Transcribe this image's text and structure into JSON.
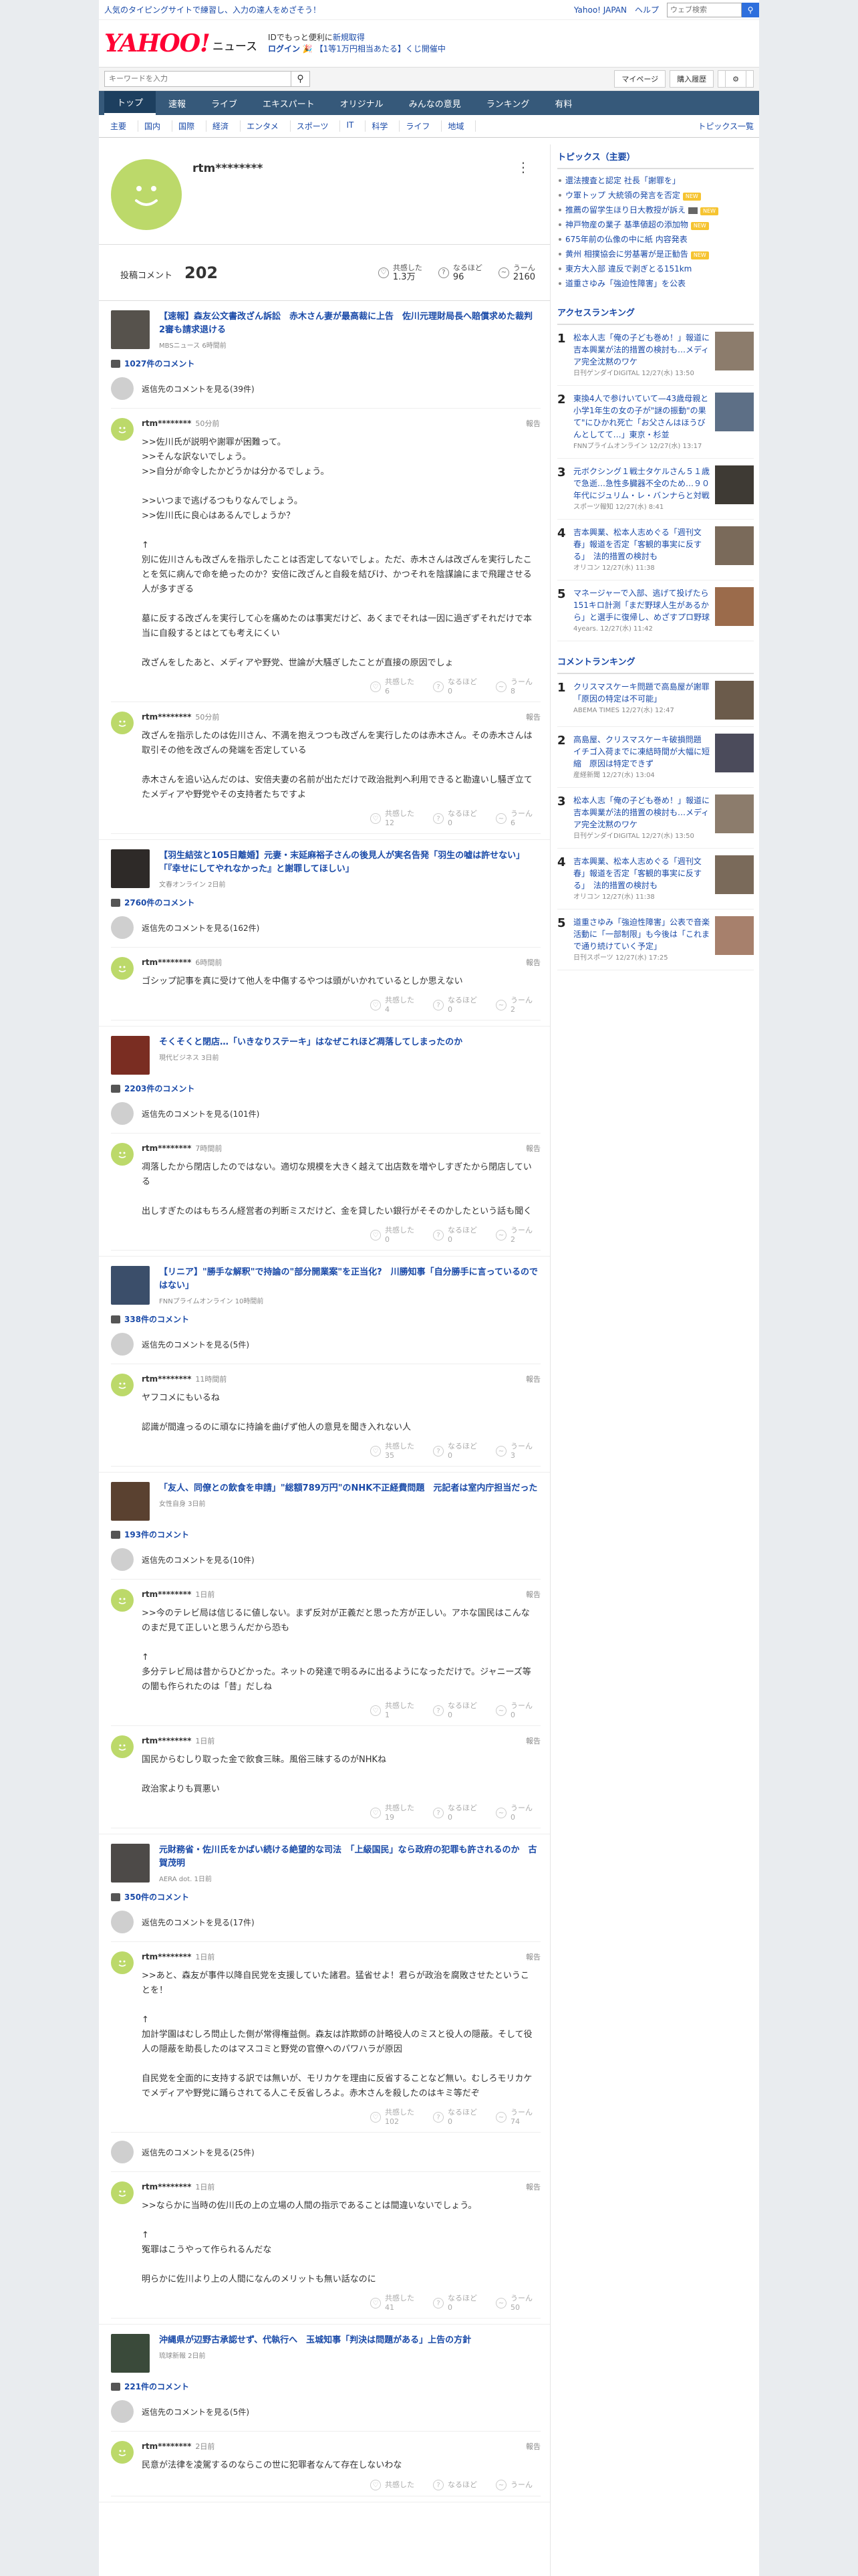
{
  "promo": {
    "left": "人気のタイピングサイトで練習し、入力の達人をめざそう！",
    "links": [
      "Yahoo! JAPAN",
      "ヘルプ"
    ],
    "search_placeholder": "ウェブ検索"
  },
  "brand": {
    "logo": "YAHOO!",
    "logo_sub": "JAPAN",
    "section": "ニュース",
    "line1_prefix": "IDでもっと便利に",
    "line1_link": "新規取得",
    "line2_login": "ログイン",
    "line2_campaign": "【1等1万円相当あたる】くじ開催中"
  },
  "search": {
    "placeholder": "キーワードを入力",
    "mypage": "マイページ",
    "purchase": "購入履歴"
  },
  "global_nav": [
    "トップ",
    "速報",
    "ライブ",
    "エキスパート",
    "オリジナル",
    "みんなの意見",
    "ランキング",
    "有料"
  ],
  "sub_nav": [
    "主要",
    "国内",
    "国際",
    "経済",
    "エンタメ",
    "スポーツ",
    "IT",
    "科学",
    "ライフ",
    "地域"
  ],
  "sub_nav_all": "トピックス一覧",
  "profile": {
    "name": "rtm********",
    "comments_label": "投稿コメント",
    "comments_count": "202",
    "reactions": [
      {
        "label": "共感した",
        "value": "1.3万"
      },
      {
        "label": "なるほど",
        "value": "96"
      },
      {
        "label": "うーん",
        "value": "2160"
      }
    ]
  },
  "labels": {
    "view_prev": "返信先のコメントを見る",
    "report": "報告",
    "agree": "共感した",
    "hmm": "なるほど",
    "well": "うーん"
  },
  "articles": [
    {
      "title": "【速報】森友公文書改ざん訴訟　赤木さん妻が最高裁に上告　佐川元理財局長へ賠償求めた裁判　2審も請求退ける",
      "source": "MBSニュース 6時間前",
      "thumb": "#56524c",
      "comment_count": "1027件のコメント",
      "prev": "返信先のコメントを見る(39件)",
      "comments": [
        {
          "user": "rtm********",
          "time": "50分前",
          "text": ">>佐川氏が説明や謝罪が困難って。\n>>そんな訳ないでしょう。\n>>自分が命令したかどうかは分かるでしょう。\n\n>>いつまで逃げるつもりなんでしょう。\n>>佐川氏に良心はあるんでしょうか？\n\n↑\n別に佐川さんも改ざんを指示したことは否定してないでしょ。ただ、赤木さんは改ざんを実行したことを気に病んで命を絶ったのか？安倍に改ざんと自殺を結びけ、かつそれを陰謀論にまで飛躍させる人が多すぎる\n\n墓に反する改ざんを実行して心を痛めたのは事実だけど、あくまでそれは一因に過ぎずそれだけで本当に自殺するとはとても考えにくい\n\n改ざんをしたあと、メディアや野党、世論が大騒ぎしたことが直接の原因でしょ",
          "r": [
            "6",
            "0",
            "8"
          ]
        },
        {
          "user": "rtm********",
          "time": "50分前",
          "text": "改ざんを指示したのは佐川さん、不満を抱えつつも改ざんを実行したのは赤木さん。その赤木さんは取引その他を改ざんの発端を否定している\n\n赤木さんを追い込んだのは、安倍夫妻の名前が出ただけで政治批判へ利用できると勘違いし騒ぎ立てたメディアや野党やその支持者たちですよ",
          "r": [
            "12",
            "0",
            "6"
          ]
        }
      ]
    },
    {
      "title": "【羽生結弦と105日離婚】元妻・末延麻裕子さんの後見人が実名告発「羽生の嘘は許せない」「『幸せにしてやれなかった』と謝罪してほしい」",
      "source": "文春オンライン 2日前",
      "thumb": "#2e2a28",
      "comment_count": "2760件のコメント",
      "prev": "返信先のコメントを見る(162件)",
      "comments": [
        {
          "user": "rtm********",
          "time": "6時間前",
          "text": "ゴシップ記事を真に受けて他人を中傷するやつは頭がいかれているとしか思えない",
          "r": [
            "4",
            "0",
            "2"
          ]
        }
      ]
    },
    {
      "title": "そくそくと閉店…「いきなりステーキ」はなぜこれほど凋落してしまったのか",
      "source": "現代ビジネス 3日前",
      "thumb": "#7a2d22",
      "comment_count": "2203件のコメント",
      "prev": "返信先のコメントを見る(101件)",
      "comments": [
        {
          "user": "rtm********",
          "time": "7時間前",
          "text": "凋落したから閉店したのではない。適切な規模を大きく越えて出店数を増やしすぎたから閉店している\n\n出しすぎたのはもちろん経営者の判断ミスだけど、金を貸したい銀行がそそのかしたという話も聞く",
          "r": [
            "0",
            "0",
            "2"
          ]
        }
      ]
    },
    {
      "title": "【リニア】\"勝手な解釈\"で持論の\"部分開業案\"を正当化?　川勝知事「自分勝手に言っているのではない」",
      "source": "FNNプライムオンライン 10時間前",
      "thumb": "#3b4e6a",
      "comment_count": "338件のコメント",
      "prev": "返信先のコメントを見る(5件)",
      "comments": [
        {
          "user": "rtm********",
          "time": "11時間前",
          "text": "ヤフコメにもいるね\n\n認識が間違っるのに頑なに持論を曲げず他人の意見を聞き入れない人",
          "r": [
            "35",
            "0",
            "3"
          ]
        }
      ]
    },
    {
      "title": "「友人、同僚との飲食を申請」\"総額789万円\"のNHK不正経費問題　元記者は室内庁担当だった",
      "source": "女性自身 3日前",
      "thumb": "#5a4130",
      "comment_count": "193件のコメント",
      "prev": "返信先のコメントを見る(10件)",
      "comments": [
        {
          "user": "rtm********",
          "time": "1日前",
          "text": ">>今のテレビ局は信じるに値しない。まず反対が正義だと思った方が正しい。アホな国民はこんなのまだ見て正しいと思うんだから恐も\n\n↑\n多分テレビ局は昔からひどかった。ネットの発達で明るみに出るようになっただけで。ジャニーズ等の闇も作られたのは「昔」だしね",
          "r": [
            "1",
            "0",
            "0"
          ]
        },
        {
          "user": "rtm********",
          "time": "1日前",
          "text": "国民からむしり取った金で飲食三昧。風俗三昧するのがNHKね\n\n政治家よりも買悪い",
          "r": [
            "19",
            "0",
            "0"
          ]
        }
      ]
    },
    {
      "title": "元財務省・佐川氏をかばい続ける絶望的な司法　「上級国民」なら政府の犯罪も許されるのか　古賀茂明",
      "source": "AERA dot. 1日前",
      "thumb": "#4d4a48",
      "comment_count": "350件のコメント",
      "prev": "返信先のコメントを見る(17件)",
      "comments": [
        {
          "user": "rtm********",
          "time": "1日前",
          "text": ">>あと、森友が事件以降自民党を支援していた諸君。猛省せよ！君らが政治を腐敗させたということを！\n\n↑\n加計学園はむしろ問止した側が常得権益側。森友は詐欺師の計略役人のミスと役人の隠蔽。そして役人の隠蔽を助長したのはマスコミと野党の官僚へのパワハラが原因\n\n自民党を全面的に支持する訳では無いが、モリカケを理由に反省することなど無い。むしろモリカケでメディアや野党に踊らされてる人こそ反省しろよ。赤木さんを殺したのはキミ等だぞ",
          "r": [
            "102",
            "0",
            "74"
          ]
        }
      ],
      "prev2": "返信先のコメントを見る(25件)",
      "comments2": [
        {
          "user": "rtm********",
          "time": "1日前",
          "text": ">>ならかに当時の佐川氏の上の立場の人間の指示であることは間違いないでしょう。\n\n↑\n冤罪はこうやって作られるんだな\n\n明らかに佐川より上の人間になんのメリットも無い話なのに",
          "r": [
            "41",
            "0",
            "50"
          ]
        }
      ]
    },
    {
      "title": "沖縄県が辺野古承認せず、代執行へ　玉城知事「判決は問題がある」上告の方針",
      "source": "琉球新報 2日前",
      "thumb": "#3a4a3a",
      "comment_count": "221件のコメント",
      "prev": "返信先のコメントを見る(5件)",
      "comments": [
        {
          "user": "rtm********",
          "time": "2日前",
          "text": "民意が法律を凌駕するのならこの世に犯罪者なんて存在しないわな",
          "r": [
            "",
            "",
            ""
          ]
        }
      ]
    }
  ],
  "topics": {
    "title": "トピックス（主要）",
    "items": [
      {
        "text": "還法捜査と認定 社長「謝罪を」",
        "badge": ""
      },
      {
        "text": "ウ軍トップ 大統領の発言を否定",
        "badge": "new"
      },
      {
        "text": "推薦の留学生ほり日大教授が訴え",
        "badge": "camnew"
      },
      {
        "text": "神戸物産の業子 基準値超の添加物",
        "badge": "new"
      },
      {
        "text": "675年前の仏像の中に紙 内容発表",
        "badge": ""
      },
      {
        "text": "黄州 相撲協会に労基署が是正勧告",
        "badge": "new"
      },
      {
        "text": "東方大入部 違反で剥ぎとる151km",
        "badge": ""
      },
      {
        "text": "道重さゆみ「強迫性障害」を公表",
        "badge": ""
      }
    ]
  },
  "access_ranking": {
    "title": "アクセスランキング",
    "items": [
      {
        "no": "1",
        "title": "松本人志「俺の子ども巻め！」報道に吉本興業が法的措置の検討も…メディア完全沈黙のワケ",
        "src": "日刊ゲンダイDIGITAL 12/27(水) 13:50",
        "thumb": "#8c7c6c"
      },
      {
        "no": "2",
        "title": "東換4人で参けいていて—43歳母親と小学1年生の女の子が\"謎の振動\"の果て\"にひかれ死亡「お父さんはほうびんとしてて…」東京・杉並",
        "src": "FNNプライムオンライン 12/27(水) 13:17",
        "thumb": "#5d6f86"
      },
      {
        "no": "3",
        "title": "元ボクシング１戦士タケルさん５１歳で急逝…急性多臓器不全のため…９０年代にジュリム・レ・バンナらと対戦",
        "src": "スポーツ報知 12/27(水) 8:41",
        "thumb": "#3e3a34"
      },
      {
        "no": "4",
        "title": "吉本興業、松本人志めぐる「週刊文春」報道を否定「客観的事実に反する」　法的措置の検討も",
        "src": "オリコン 12/27(水) 11:38",
        "thumb": "#7a6a5a"
      },
      {
        "no": "5",
        "title": "マネージャーで入部、逃げて投げたら151キロ計測「まだ野球人生があるから」と選手に復帰し、めざすプロ野球",
        "src": "4years. 12/27(水) 11:42",
        "thumb": "#9b6b4b"
      }
    ]
  },
  "comment_ranking": {
    "title": "コメントランキング",
    "items": [
      {
        "no": "1",
        "title": "クリスマスケーキ問題で高島屋が謝罪「原因の特定は不可能」",
        "src": "ABEMA TIMES 12/27(水) 12:47",
        "thumb": "#6b5b4b"
      },
      {
        "no": "2",
        "title": "高島屋、クリスマスケーキ破損問題　イチゴ入荷までに凍結時間が大幅に短縮　原因は特定できず",
        "src": "産経新聞 12/27(水) 13:04",
        "thumb": "#4b4b5b"
      },
      {
        "no": "3",
        "title": "松本人志「俺の子ども巻め！」報道に吉本興業が法的措置の検討も…メディア完全沈黙のワケ",
        "src": "日刊ゲンダイDIGITAL 12/27(水) 13:50",
        "thumb": "#8c7c6c"
      },
      {
        "no": "4",
        "title": "吉本興業、松本人志めぐる「週刊文春」報道を否定「客観的事実に反する」　法的措置の検討も",
        "src": "オリコン 12/27(水) 11:38",
        "thumb": "#7a6a5a"
      },
      {
        "no": "5",
        "title": "道重さゆみ「強迫性障害」公表で音楽活動に「一部制限」も今後は「これまで通り続けていく予定」",
        "src": "日刊スポーツ 12/27(水) 17:25",
        "thumb": "#a7806c"
      }
    ]
  }
}
